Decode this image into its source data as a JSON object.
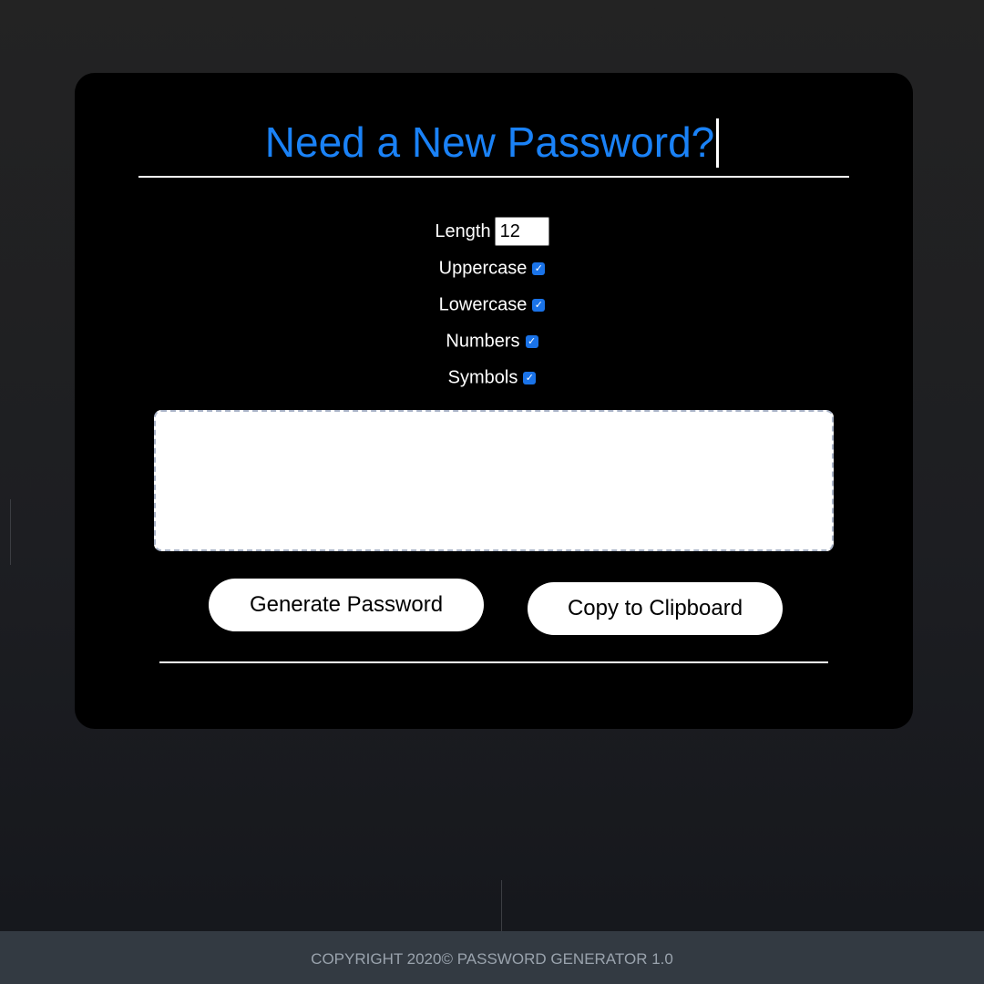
{
  "header": {
    "title": "Need a New Password?"
  },
  "options": {
    "length_label": "Length",
    "length_value": "12",
    "uppercase_label": "Uppercase",
    "uppercase_checked": true,
    "lowercase_label": "Lowercase",
    "lowercase_checked": true,
    "numbers_label": "Numbers",
    "numbers_checked": true,
    "symbols_label": "Symbols",
    "symbols_checked": true
  },
  "output": {
    "password_value": ""
  },
  "actions": {
    "generate_label": "Generate Password",
    "copy_label": "Copy to Clipboard"
  },
  "footer": {
    "copyright": "COPYRIGHT 2020© PASSWORD GENERATOR 1.0"
  },
  "colors": {
    "title": "#1a82f7",
    "card_background": "#000000",
    "page_background": "#1f2024",
    "footer_background": "#333a42",
    "checkbox_accent": "#1a73e8"
  },
  "icons": {
    "checkbox": "checkmark-icon"
  }
}
